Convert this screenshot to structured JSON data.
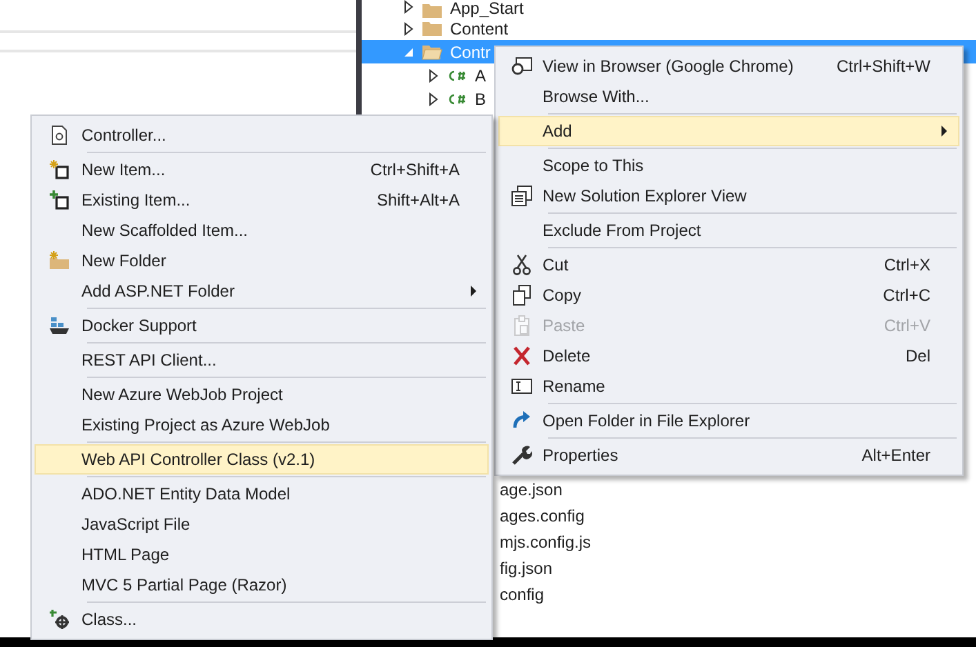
{
  "solution_explorer": {
    "items": [
      {
        "label": "App_Start",
        "kind": "folder",
        "expanded": false,
        "selected": false
      },
      {
        "label": "Content",
        "kind": "folder",
        "expanded": false,
        "selected": false
      },
      {
        "label": "Contr",
        "kind": "folder",
        "expanded": true,
        "selected": true,
        "children": [
          {
            "label": "A",
            "kind": "csharp",
            "expanded": false,
            "selected": false
          },
          {
            "label": "B",
            "kind": "csharp",
            "expanded": false,
            "selected": false
          }
        ]
      }
    ],
    "partly_hidden_files": [
      "age.json",
      "ages.config",
      "mjs.config.js",
      "fig.json",
      "config"
    ]
  },
  "context_menu": {
    "groups": [
      [
        {
          "label": "View in Browser (Google Chrome)",
          "shortcut": "Ctrl+Shift+W",
          "selected": false,
          "disabled": false
        },
        {
          "label": "Browse With...",
          "selected": false,
          "disabled": false
        }
      ],
      [
        {
          "label": "Add",
          "submenu": true,
          "selected": true,
          "disabled": false
        }
      ],
      [
        {
          "label": "Scope to This",
          "selected": false,
          "disabled": false
        },
        {
          "label": "New Solution Explorer View",
          "selected": false,
          "disabled": false
        }
      ],
      [
        {
          "label": "Exclude From Project",
          "selected": false,
          "disabled": false
        }
      ],
      [
        {
          "label": "Cut",
          "shortcut": "Ctrl+X",
          "selected": false,
          "disabled": false
        },
        {
          "label": "Copy",
          "shortcut": "Ctrl+C",
          "selected": false,
          "disabled": false
        },
        {
          "label": "Paste",
          "shortcut": "Ctrl+V",
          "selected": false,
          "disabled": true
        },
        {
          "label": "Delete",
          "shortcut": "Del",
          "selected": false,
          "disabled": false
        },
        {
          "label": "Rename",
          "selected": false,
          "disabled": false
        }
      ],
      [
        {
          "label": "Open Folder in File Explorer",
          "selected": false,
          "disabled": false
        }
      ],
      [
        {
          "label": "Properties",
          "shortcut": "Alt+Enter",
          "selected": false,
          "disabled": false
        }
      ]
    ]
  },
  "add_submenu": {
    "groups": [
      [
        {
          "label": "Controller...",
          "selected": false,
          "disabled": false
        }
      ],
      [
        {
          "label": "New Item...",
          "shortcut": "Ctrl+Shift+A",
          "selected": false,
          "disabled": false
        },
        {
          "label": "Existing Item...",
          "shortcut": "Shift+Alt+A",
          "selected": false,
          "disabled": false
        },
        {
          "label": "New Scaffolded Item...",
          "selected": false,
          "disabled": false
        },
        {
          "label": "New Folder",
          "selected": false,
          "disabled": false
        },
        {
          "label": "Add ASP.NET Folder",
          "submenu": true,
          "selected": false,
          "disabled": false
        }
      ],
      [
        {
          "label": "Docker Support",
          "selected": false,
          "disabled": false
        }
      ],
      [
        {
          "label": "REST API Client...",
          "selected": false,
          "disabled": false
        }
      ],
      [
        {
          "label": "New Azure WebJob Project",
          "selected": false,
          "disabled": false
        },
        {
          "label": "Existing Project as Azure WebJob",
          "selected": false,
          "disabled": false
        }
      ],
      [
        {
          "label": "Web API Controller Class (v2.1)",
          "selected": true,
          "disabled": false
        }
      ],
      [
        {
          "label": "ADO.NET Entity Data Model",
          "selected": false,
          "disabled": false
        },
        {
          "label": "JavaScript File",
          "selected": false,
          "disabled": false
        },
        {
          "label": "HTML Page",
          "selected": false,
          "disabled": false
        },
        {
          "label": "MVC 5 Partial Page (Razor)",
          "selected": false,
          "disabled": false
        }
      ],
      [
        {
          "label": "Class...",
          "selected": false,
          "disabled": false
        }
      ]
    ]
  }
}
